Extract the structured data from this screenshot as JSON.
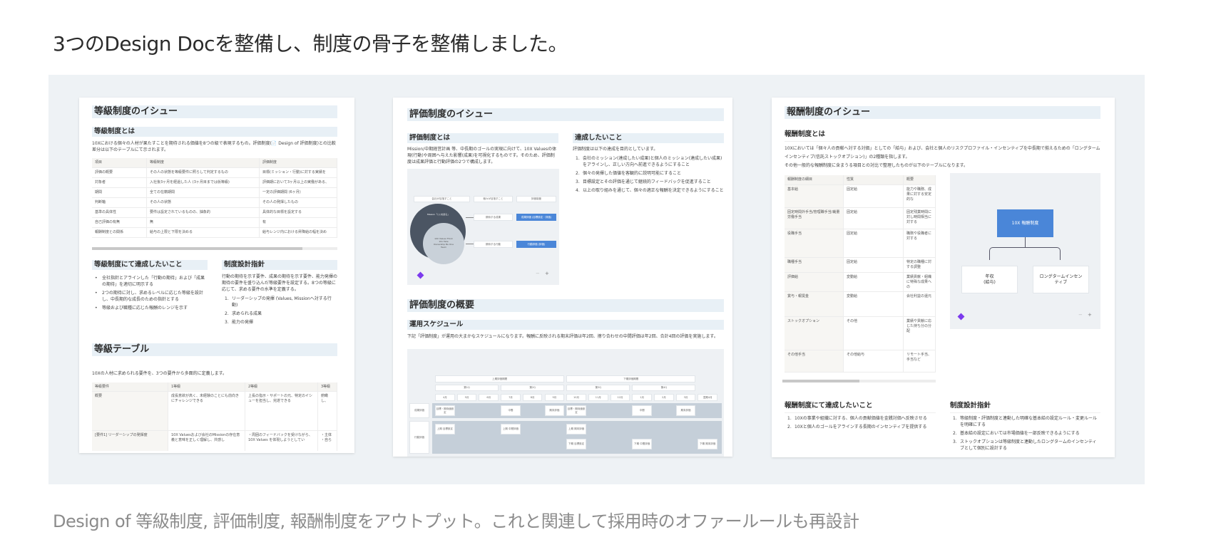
{
  "heading": "3つのDesign Docを整備し、制度の骨子を整備しました。",
  "caption": "Design of 等級制度, 評価制度, 報酬制度をアウトプット。これと関連して採用時のオファールールも再設計",
  "colors": {
    "panel": "#eef2f5",
    "band": "#e8f0f6",
    "accent": "#4a86d8",
    "logo": "#7c3aed"
  },
  "doc1": {
    "title": "等級制度のイシュー",
    "what_title": "等級制度とは",
    "what_text": "10Xにおける個々の人材が果たすことを期待される価値を8つの級で表現するもの。評価制度(📄 Design of 評価制度)との比較差分は以下のテーブルにて示されます。",
    "compare_table": {
      "headers": [
        "項目",
        "等級制度",
        "評価制度"
      ],
      "rows": [
        [
          "評価の概要",
          "その人の状態を等級要件に照らして判定するもの",
          "目標(ミッション・行動)に対する実績を"
        ],
        [
          "対象者",
          "入社後3ヶ月を経過した人 (3ヶ月目までは仮等級)",
          "評価期において3ヶ月以上の実働がある、"
        ],
        [
          "期間",
          "全ての在籍期間",
          "一定の評価期間 (6ヶ月)"
        ],
        [
          "判断軸",
          "その人の状態",
          "その人の発揮したもの"
        ],
        [
          "基準の具体性",
          "要件は設定されているものの、抽象的",
          "具体的な目標を設定する"
        ],
        [
          "自己評価の有無",
          "無",
          "有"
        ],
        [
          "報酬制度との関係",
          "給与の上限と下限を決める",
          "給与レンジ内における昇降給の幅を決め"
        ]
      ]
    },
    "goals_title": "等級制度にて達成したいこと",
    "goals": [
      "全社指針とアラインした「行動の期待」および「成果の期待」を適切に明示する",
      "2つの期待に対し、求めるレベルに応じた等級を設計し、中長期的な成長のための指針とする",
      "等級および職種に応じた報酬のレンジを示す"
    ],
    "policy_title": "制度設計指針",
    "policy_text": "行動の期待を示す要件、成果の期待を示す要件、能力発揮の期待の要件を盛り込んだ等級要件を設定する。8つの等級に応じて、求める要件の水準を定義する。",
    "policy_items": [
      "リーダーシップの発揮 (Values, Missionへ対する行動)",
      "求められる成果",
      "能力の発揮"
    ],
    "grade_title": "等級テーブル",
    "grade_text": "10Xの人材に求められる要件を、3つの要件から多面的に定義します。",
    "grade_table": {
      "headers": [
        "等級要件",
        "1等級",
        "2等級",
        "3等級"
      ],
      "rows": [
        [
          "概要",
          "成長意欲が高く、未経験のことにも前向きにチャレンジできる",
          "上長の指示・サポートの元、特定のイシューを担当し、完遂できる",
          "俯瞰し、"
        ],
        [
          "[要件1] リーダーシップの発揮度",
          "10X Valuesおよび会社のMissionの存在意義と意味を正しく理解し、共感し",
          "・周囲のフィードバックを受けながら、10X Values を体現しようとしてい",
          "・主体 ・自ら"
        ]
      ]
    }
  },
  "doc2": {
    "title": "評価制度のイシュー",
    "what_title": "評価制度とは",
    "what_text": "Mission/中期経営計画 等、中長期のゴールの実現に向けて、10X Valuesの体現(行動)や周囲へ与えた影響(成果)を可視化するものです。そのため、評価制度は成果評価と行動評価の2つで構成します。",
    "diagram": {
      "headers": [
        "会社が目指すこと",
        "個々が目指すこと",
        "評価制度"
      ],
      "mission": "Mission「○○を創る」",
      "values": "10X Values Think 10x Take Ownership Be One Team",
      "row1": [
        "期待する成果",
        "成果評価 (目標設定・評価)"
      ],
      "row2": [
        "期待する行動",
        "行動評価 (評価)"
      ],
      "zoom_out": "−",
      "zoom_in": "+"
    },
    "goals_title": "達成したいこと",
    "goals_text": "評価制度は以下の達成を目的としています。",
    "goals": [
      "会社のミッション(達成したい成果)と個人のミッション(達成したい成果)をアラインし、正しい方向へ前進できるようにすること",
      "個々の発揮した価値を客観的に説明可能にすること",
      "目標設定とその評価を通じて継続的フィードバックを促進すること",
      "以上の取り組みを通じて、個々の適正な報酬を決定できるようにすること"
    ],
    "overview_title": "評価制度の概要",
    "schedule_title": "運用スケジュール",
    "schedule_text": "下記「評価制度」が運用の大まかなスケジュールになります。報酬に反映される期末評価は年2回、擦り合わせの中間評価は年2回、合計4回の評価を実施します。",
    "schedule": {
      "halves": [
        "上期評価期間",
        "下期評価期間"
      ],
      "quarters": [
        "第1Q",
        "第2Q",
        "第3Q",
        "第4Q"
      ],
      "months": [
        "4月",
        "5月",
        "6月",
        "7月",
        "8月",
        "9月",
        "10月",
        "11月",
        "12月",
        "1月",
        "2月",
        "3月",
        "翌期4月"
      ],
      "lanes": [
        "成果評価",
        "行動評価"
      ],
      "lane1": [
        [
          "目標・期待値設定",
          0
        ],
        [
          "中間",
          3
        ],
        [
          "期末評価",
          5
        ],
        [
          "目標・期待値設定",
          6
        ],
        [
          "中間",
          9
        ],
        [
          "期末評価",
          11
        ]
      ],
      "lane2_top": [
        [
          "上期 目標設定",
          0
        ],
        [
          "上期 中間評価",
          3
        ],
        [
          "上期 期末評価",
          6
        ]
      ],
      "lane2_bottom": [
        [
          "下期 目標設定",
          6
        ],
        [
          "下期 中間評価",
          9
        ],
        [
          "下期 期末評価",
          12
        ]
      ]
    }
  },
  "doc3": {
    "title": "報酬制度のイシュー",
    "what_title": "報酬制度とは",
    "what_text1": "10Xにおいては「個々人の貢献へ対する対価」としての「給与」および、会社と個人のリスクプロファイル・インセンティブを中長期で揃えるための「ロングタームインセンティブ(信託ストックオプション)」の2種類を指します。",
    "what_text2": "その他一般的な報酬制度に含まうる項目との対比で整理したものが以下のテーブルになります。",
    "table": {
      "headers": [
        "報酬制度の細目",
        "性質",
        "概要"
      ],
      "rows": [
        [
          "基本給",
          "固定給",
          "能力や職務、成果に対する安定的な"
        ],
        [
          "固定時間外手当/管理職手当/裁量労働手当",
          "固定給",
          "固定残業時間に対し時間相当に対する"
        ],
        [
          "役職手当",
          "固定給",
          "職務や役職者に対する"
        ],
        [
          "職種手当",
          "固定給",
          "特定の職種に対する調整"
        ],
        [
          "評価給",
          "変動給",
          "業績貢献・組織に特殊な成果への"
        ],
        [
          "賞与・報奨金",
          "変動給",
          "会社利益の還元"
        ],
        [
          "ストックオプション",
          "その他",
          "業績や貢献に応じた持ち分の分配"
        ],
        [
          "その他手当",
          "その他給与",
          "リモート手当、手当など"
        ]
      ]
    },
    "diagram": {
      "root": "10X 報酬制度",
      "left": "年収\n(給与)",
      "right": "ロングタームインセンティブ",
      "zoom_out": "−",
      "zoom_in": "+"
    },
    "goals_title": "報酬制度にて達成したいこと",
    "goals": [
      "10Xの事業や組織に対する、個人の貢献価値を金銭対価へ反映させる",
      "10Xと個人のゴールをアラインする長期のインセンティブを提供する"
    ],
    "policy_title": "制度設計指針",
    "policy": [
      "等級制度・評価制度と連動した明確な基本給の設定ルール・変更ルールを明確にする",
      "基本給の設定においては市場価値を一部反映できるようにする",
      "ストックオプションは等級制度と連動したロングタームのインセンティブとして個別に設計する"
    ]
  }
}
